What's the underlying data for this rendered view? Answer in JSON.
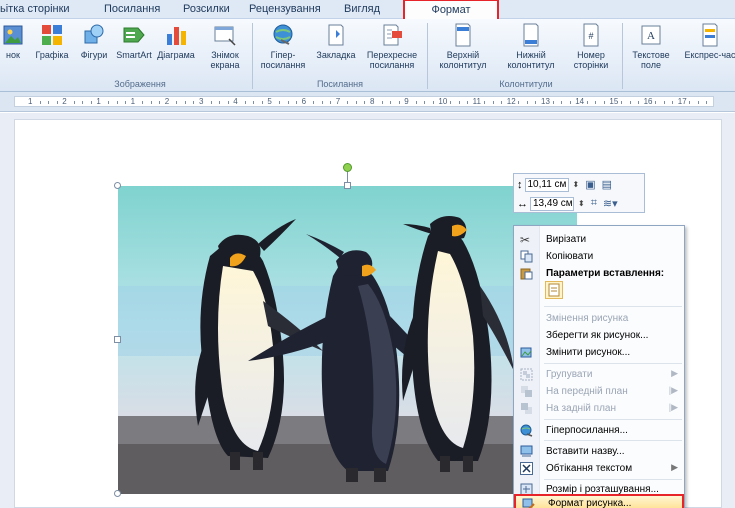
{
  "tabs": [
    {
      "label": "ьітка сторінки"
    },
    {
      "label": "Посилання"
    },
    {
      "label": "Розсилки"
    },
    {
      "label": "Рецензування"
    },
    {
      "label": "Вигляд"
    },
    {
      "label": "Формат",
      "active": true
    }
  ],
  "ribbon": {
    "illustrations": {
      "buttons": [
        {
          "label": "нок",
          "icon": "picture-icon"
        },
        {
          "label": "Графіка",
          "icon": "clipart-icon"
        },
        {
          "label": "Фігури",
          "icon": "shapes-icon"
        },
        {
          "label": "SmartArt",
          "icon": "smartart-icon"
        },
        {
          "label": "Діаграма",
          "icon": "chart-icon"
        },
        {
          "label": "Знімок екрана",
          "icon": "screenshot-icon"
        }
      ],
      "group_label": "Зображення"
    },
    "links": {
      "buttons": [
        {
          "label": "Гіпер-посилання",
          "icon": "hyperlink-icon"
        },
        {
          "label": "Закладка",
          "icon": "bookmark-icon"
        },
        {
          "label": "Перехресне посилання",
          "icon": "cross-reference-icon"
        }
      ],
      "group_label": "Посилання"
    },
    "header_footer": {
      "buttons": [
        {
          "label": "Верхній колонтитул",
          "icon": "header-icon"
        },
        {
          "label": "Нижній колонтитул",
          "icon": "footer-icon"
        },
        {
          "label": "Номер сторінки",
          "icon": "page-number-icon"
        }
      ],
      "group_label": "Колонтитули"
    },
    "text": {
      "buttons": [
        {
          "label": "Текстове поле",
          "icon": "textbox-icon"
        },
        {
          "label": "Експрес-час",
          "icon": "quickparts-icon"
        }
      ]
    }
  },
  "ruler": {
    "labels": [
      "1",
      "2",
      "1",
      "1",
      "2",
      "3",
      "4",
      "5",
      "6",
      "7",
      "8",
      "9",
      "10",
      "11",
      "12",
      "13",
      "14",
      "15",
      "16",
      "17"
    ]
  },
  "size_toolbar": {
    "height_value": "10,11 см",
    "width_value": "13,49 см"
  },
  "context_menu": {
    "items": [
      {
        "label": "Вирізати",
        "icon": "cut-icon"
      },
      {
        "label": "Копіювати",
        "icon": "copy-icon"
      },
      {
        "label": "Параметри вставлення:",
        "icon": "paste-icon",
        "bold": true
      },
      {
        "label": "Змінення рисунка",
        "disabled": true
      },
      {
        "label": "Зберегти як рисунок..."
      },
      {
        "label": "Змінити рисунок...",
        "icon": "change-picture-icon"
      },
      {
        "label": "Групувати",
        "icon": "group-icon",
        "disabled": true,
        "submenu": true
      },
      {
        "label": "На передній план",
        "icon": "bring-front-icon",
        "disabled": true,
        "submenu": true
      },
      {
        "label": "На задній план",
        "icon": "send-back-icon",
        "disabled": true,
        "submenu": true
      },
      {
        "label": "Гіперпосилання...",
        "icon": "hyperlink-icon"
      },
      {
        "label": "Вставити назву...",
        "icon": "caption-icon"
      },
      {
        "label": "Обтікання текстом",
        "icon": "wrap-text-icon",
        "submenu": true
      },
      {
        "label": "Розмір і розташування...",
        "icon": "size-position-icon"
      },
      {
        "label": "Формат рисунка...",
        "icon": "format-picture-icon",
        "highlighted": true
      }
    ]
  },
  "colors": {
    "highlight_red": "#e8242b",
    "ribbon_text": "#1e395b",
    "menu_highlight": "#ffe39a"
  }
}
